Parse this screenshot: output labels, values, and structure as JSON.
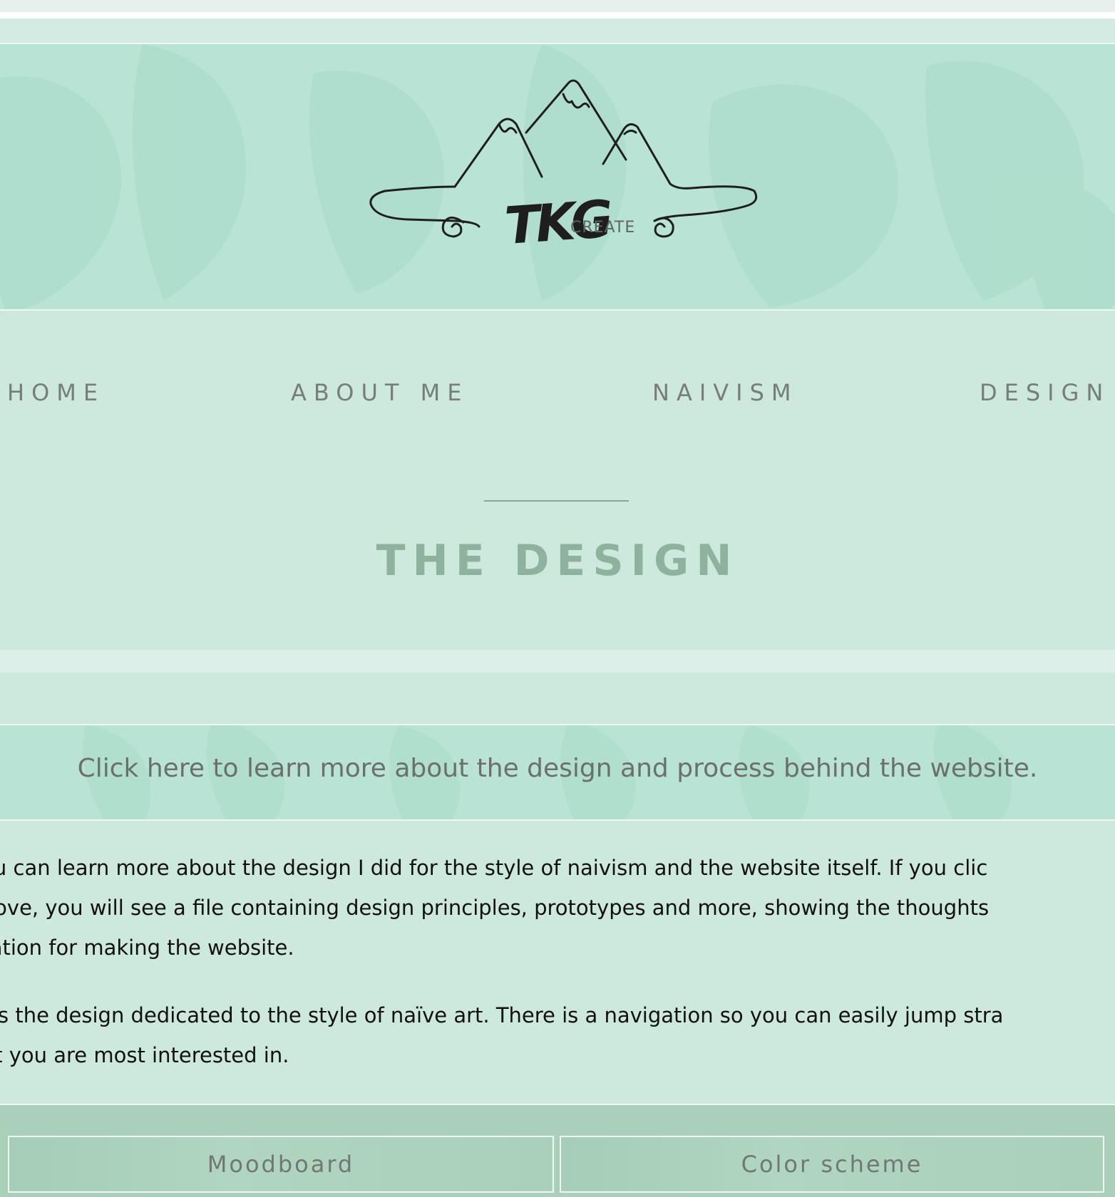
{
  "brand": {
    "logo_mark": "TKG",
    "logo_sub": "CREATE"
  },
  "nav": {
    "items": [
      "HOME",
      "ABOUT ME",
      "NAIVISM",
      "DESIGN"
    ]
  },
  "page": {
    "title": "THE DESIGN"
  },
  "cta": {
    "text": "Click here to learn more about the design and process behind the website."
  },
  "body": {
    "paragraph1_lines": [
      "you can learn more about the design I did for the style of naivism and the website itself. If you clic",
      "above, you will see a file containing design principles, prototypes and more, showing the thoughts",
      "aration for making the website."
    ],
    "paragraph2_lines": [
      "w is the design dedicated to the style of naïve art. There is a navigation so you can easily jump stra",
      "hat you are most interested in."
    ]
  },
  "buttons": {
    "moodboard": "Moodboard",
    "color_scheme": "Color scheme"
  },
  "colors": {
    "background": "#cde8dd",
    "hero": "#b9e3d4",
    "nav_text": "#777e7a",
    "title": "#8fb29f",
    "bottom_bar": "#aad0b9"
  }
}
